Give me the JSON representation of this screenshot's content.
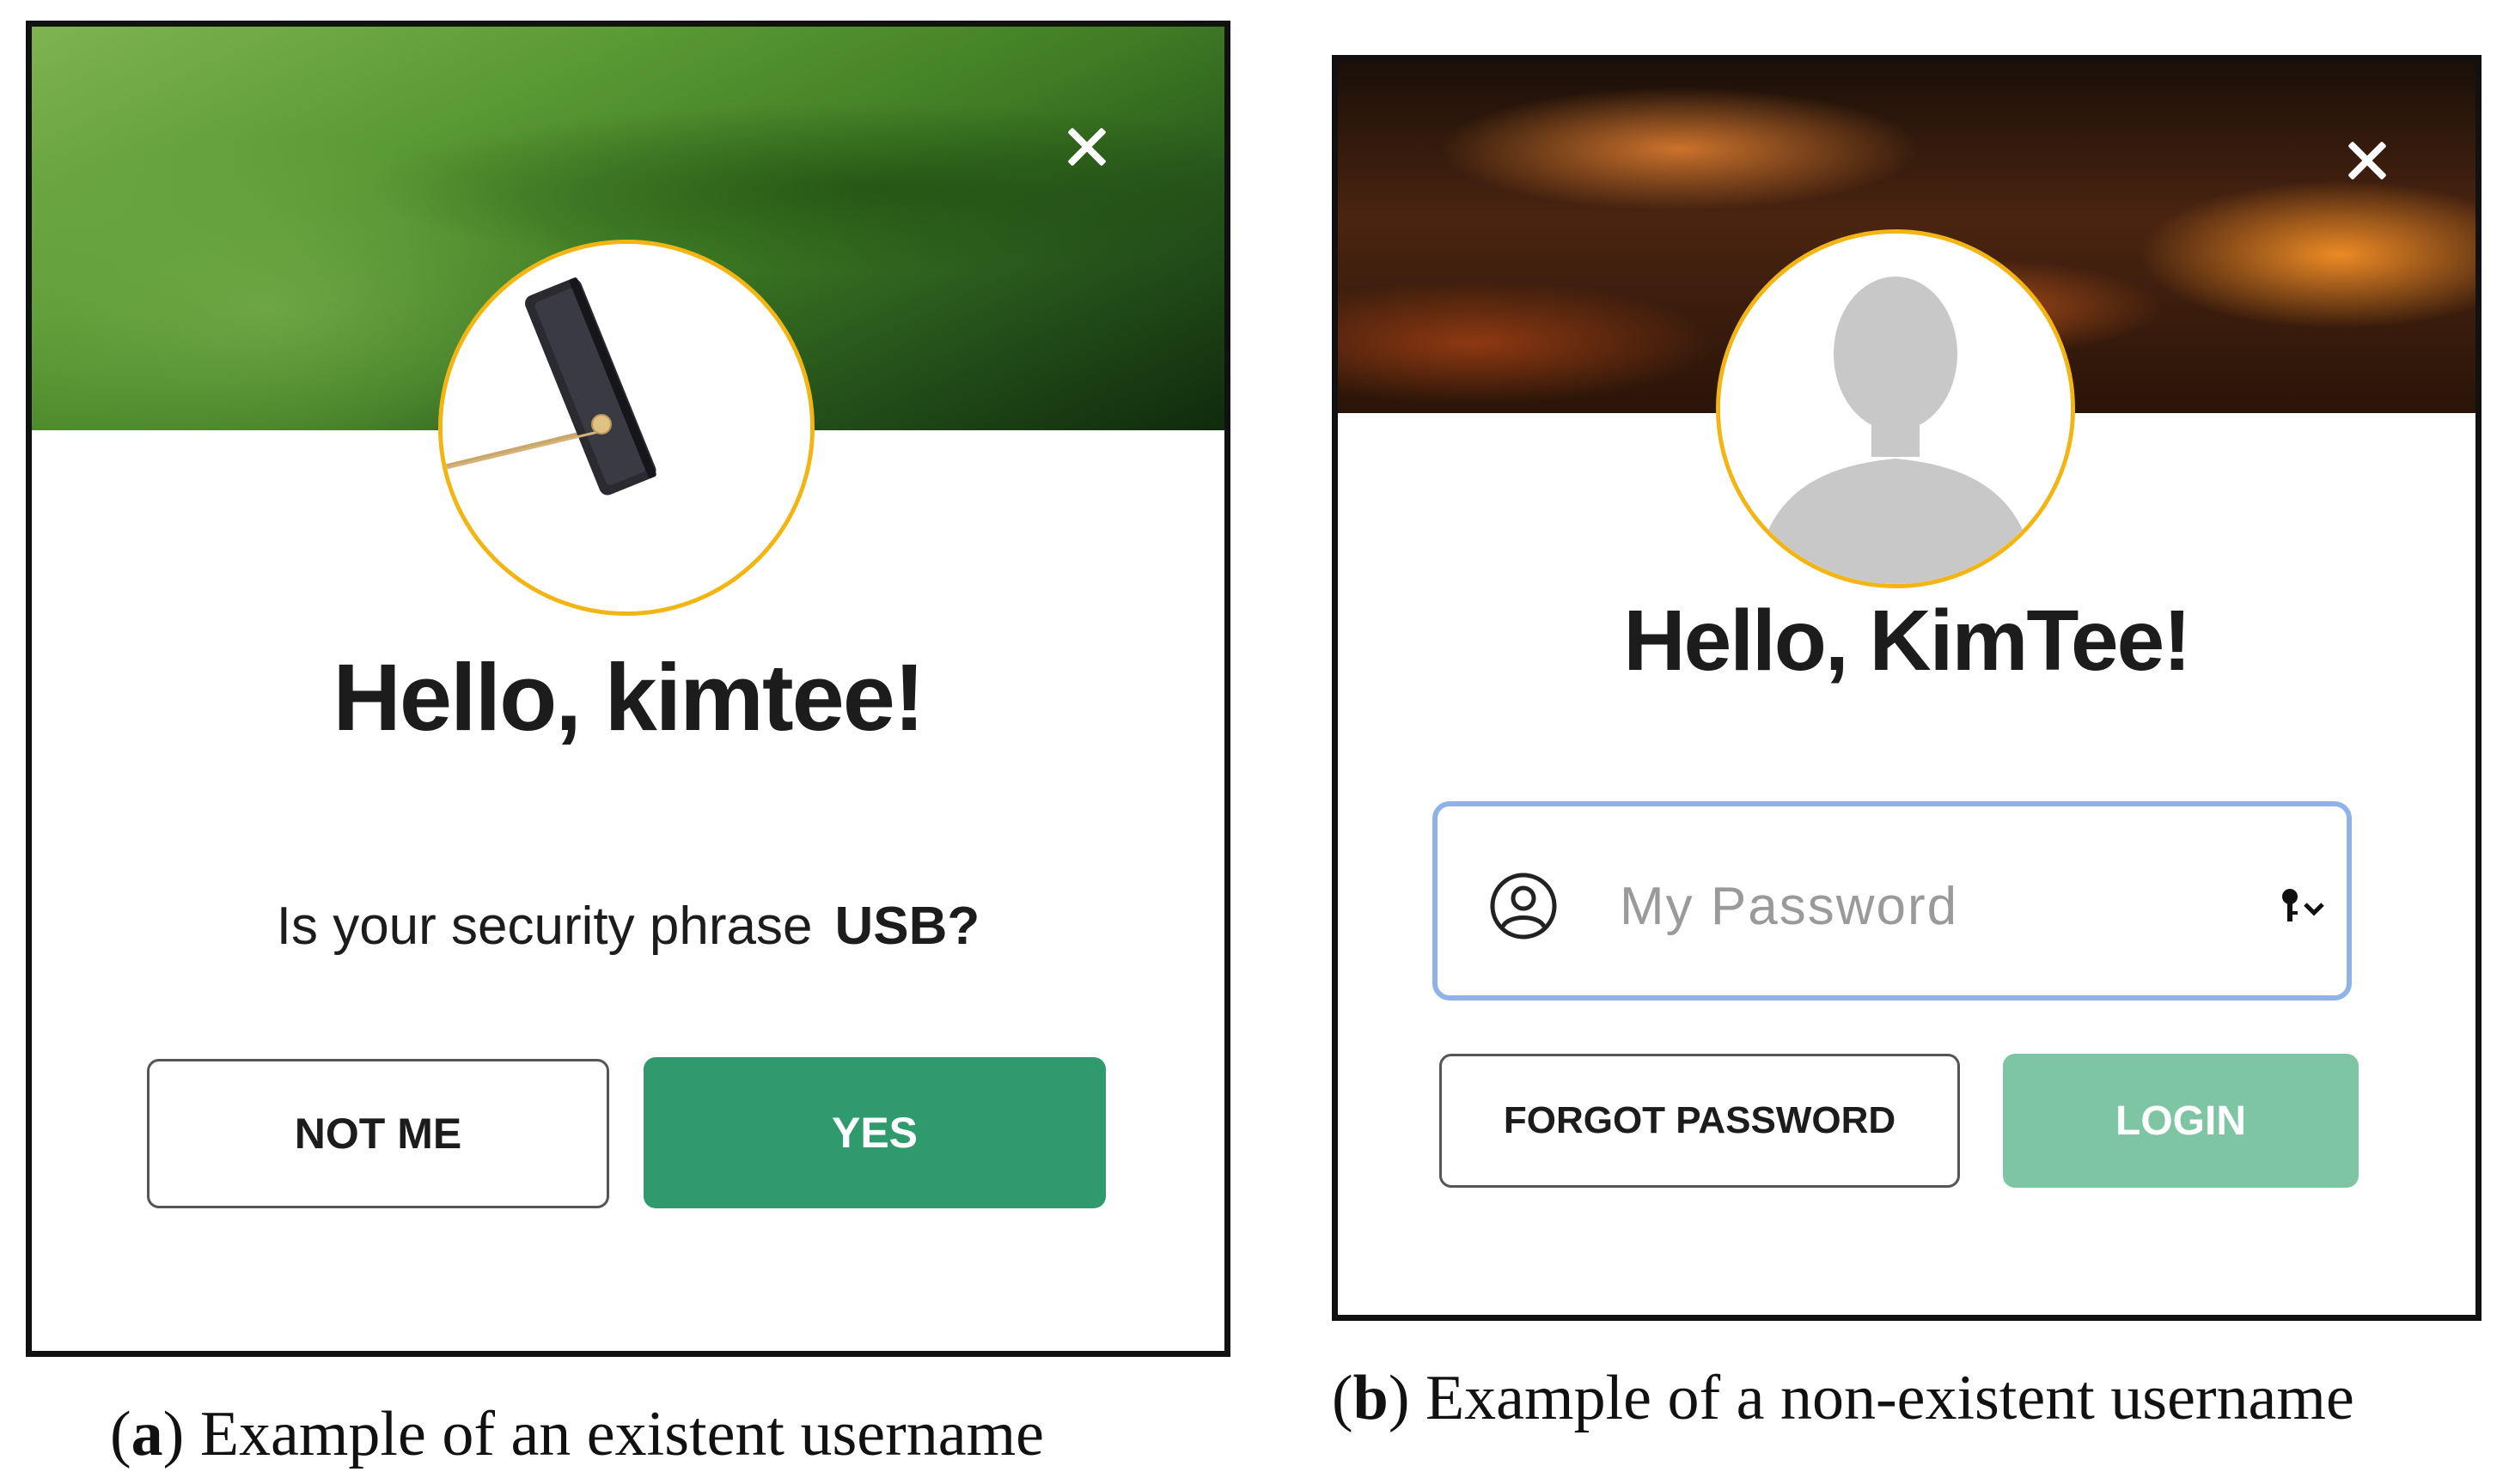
{
  "panel_a": {
    "heading": "Hello, kimtee!",
    "question_text": "Is your security phrase",
    "security_phrase": "USB?",
    "not_me_label": "NOT ME",
    "yes_label": "YES",
    "caption_letter": "a",
    "caption_text": "Example of an existent username"
  },
  "panel_b": {
    "heading": "Hello, KimTee!",
    "password_placeholder": "My Password",
    "forgot_label": "FORGOT PASSWORD",
    "login_label": "LOGIN",
    "caption_letter": "b",
    "caption_text": "Example of a non-existent username"
  },
  "icons": {
    "close": "close-icon",
    "user": "user-circle-icon",
    "key": "key-dropdown-icon",
    "avatar_default": "person-silhouette-icon",
    "avatar_usb": "usb-drive-image"
  },
  "colors": {
    "primary_button": "#2f9a6c",
    "primary_button_disabled": "#7ec6a3",
    "avatar_ring": "#f2b514",
    "input_focus_border": "#8fb2e8"
  }
}
